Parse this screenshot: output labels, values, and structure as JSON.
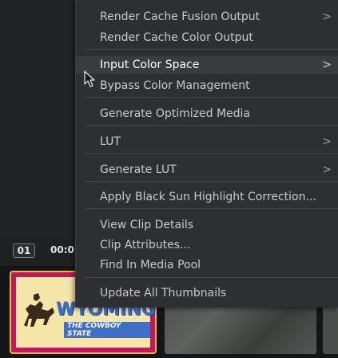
{
  "menu": {
    "items": [
      {
        "label": "Render Cache Fusion Output",
        "submenu": true
      },
      {
        "label": "Render Cache Color Output",
        "submenu": false
      },
      {
        "label": "Input Color Space",
        "submenu": true,
        "highlighted": true
      },
      {
        "label": "Bypass Color Management",
        "submenu": false
      },
      {
        "label": "Generate Optimized Media",
        "submenu": false
      },
      {
        "label": "LUT",
        "submenu": true
      },
      {
        "label": "Generate LUT",
        "submenu": true
      },
      {
        "label": "Apply Black Sun Highlight Correction...",
        "submenu": false
      },
      {
        "label": "View Clip Details",
        "submenu": false
      },
      {
        "label": "Clip Attributes...",
        "submenu": false
      },
      {
        "label": "Find In Media Pool",
        "submenu": false
      },
      {
        "label": "Update All Thumbnails",
        "submenu": false
      }
    ],
    "submenu_arrow": ">"
  },
  "clip": {
    "number": "01",
    "timecode_partial": "00:0"
  },
  "thumbnail": {
    "title": "WYOMING",
    "subtitle": "THE COWBOY STATE"
  },
  "colors": {
    "menu_bg": "#2e2f32",
    "highlight_bg": "#3a3b3f",
    "selection_border": "#e8b84a"
  },
  "icons": [
    "mouse-pointer-icon",
    "submenu-arrow-icon",
    "bucking-horse-icon"
  ]
}
